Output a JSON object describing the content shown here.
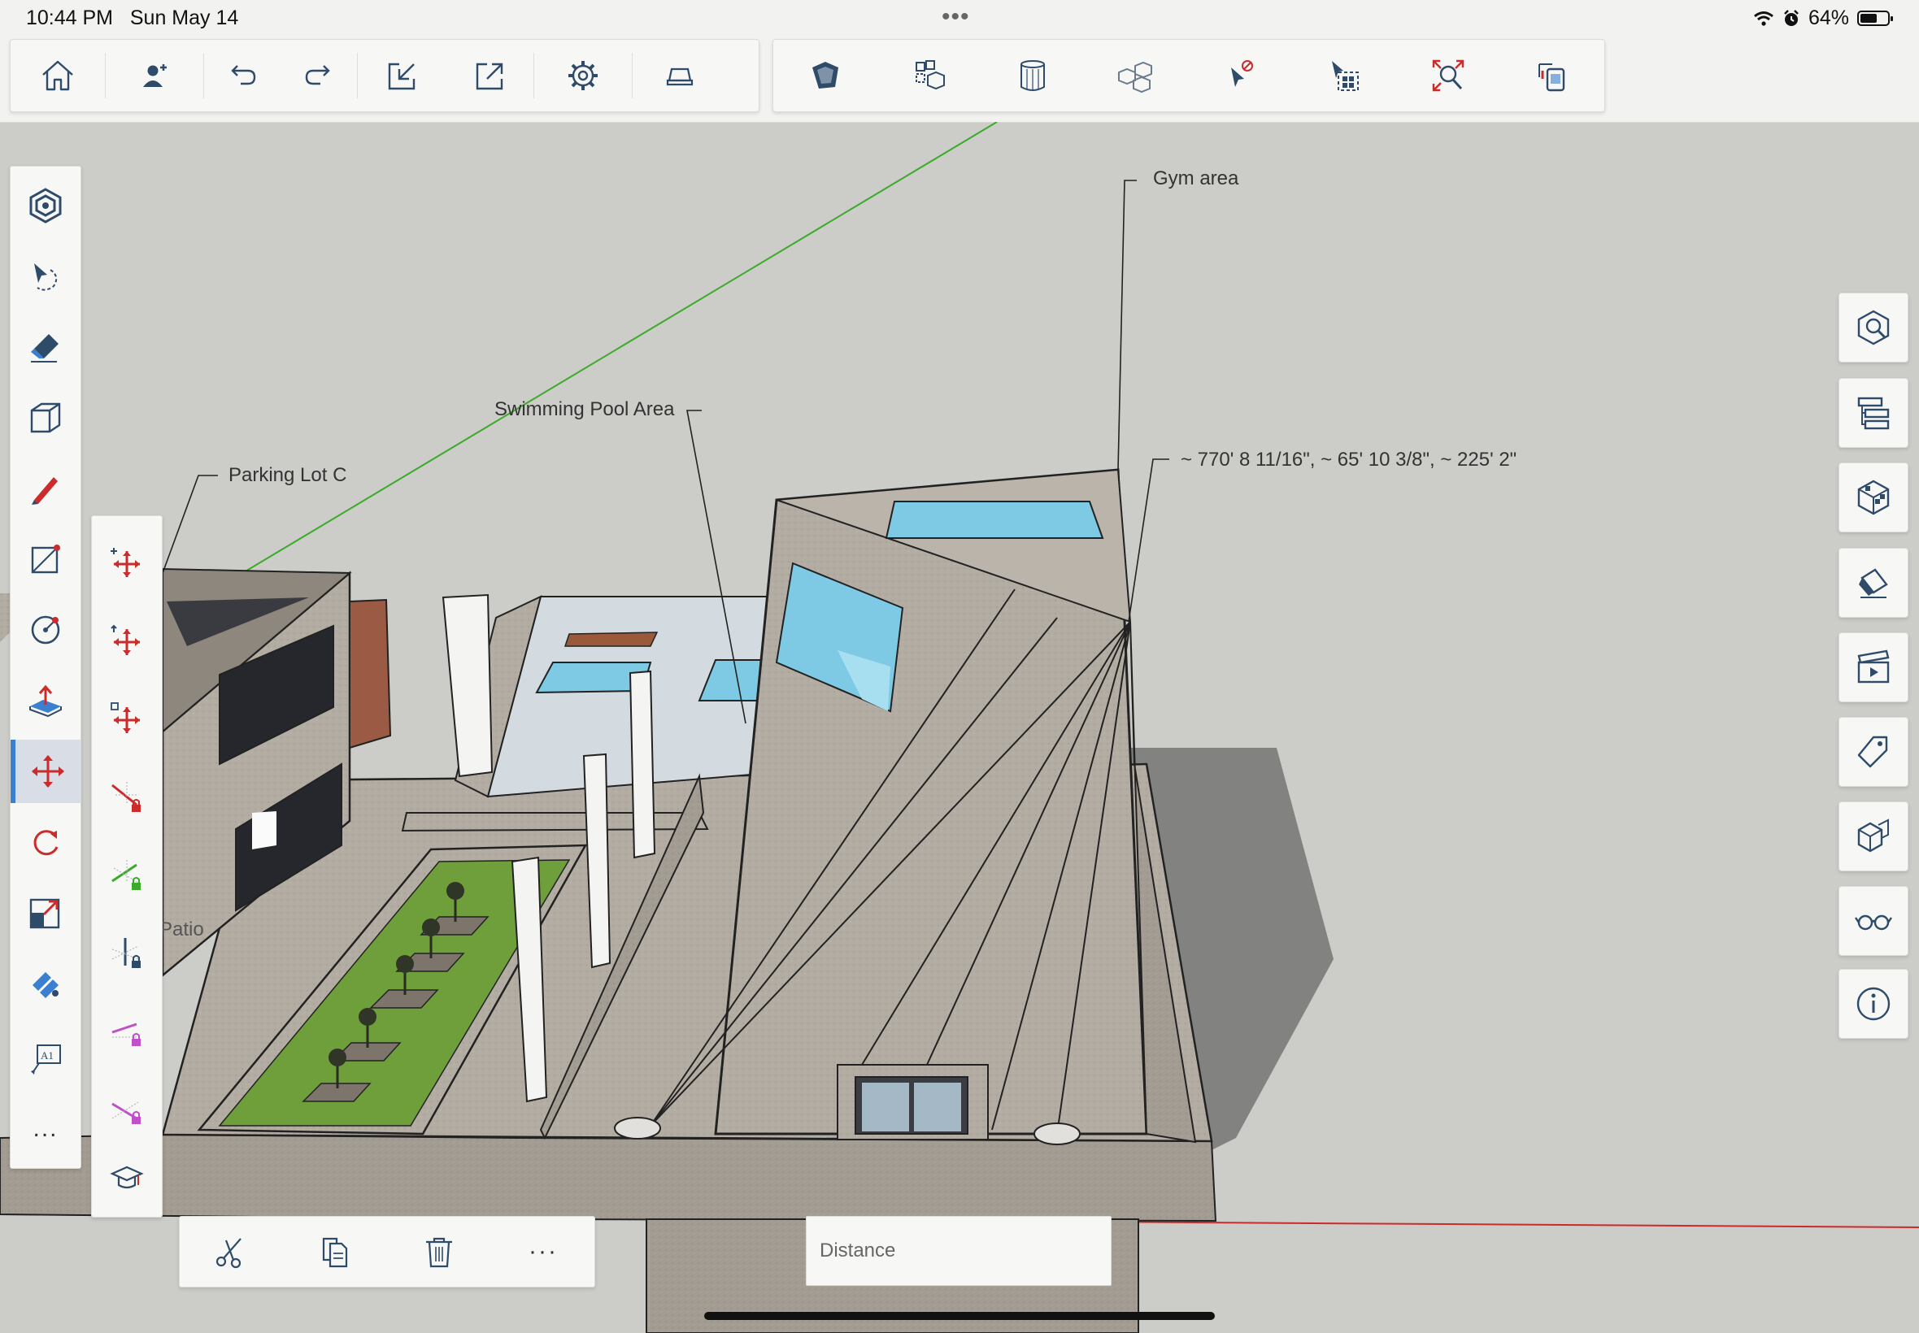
{
  "status": {
    "time": "10:44 PM",
    "date": "Sun May 14",
    "battery_text": "64%",
    "battery_level": 0.64,
    "dots": "•••"
  },
  "toolbar_left": [
    {
      "name": "home-button",
      "icon": "home-icon"
    },
    {
      "name": "profile-button",
      "icon": "add-person-icon"
    },
    {
      "name": "undo-button",
      "icon": "undo-icon"
    },
    {
      "name": "redo-button",
      "icon": "redo-icon"
    },
    {
      "name": "import-button",
      "icon": "import-icon"
    },
    {
      "name": "export-button",
      "icon": "export-icon"
    },
    {
      "name": "settings-button",
      "icon": "gear-icon"
    },
    {
      "name": "hardware-button",
      "icon": "laptop-icon"
    }
  ],
  "toolbar_right": [
    {
      "name": "section-plane-button",
      "icon": "box-section-icon"
    },
    {
      "name": "components-button",
      "icon": "components-icon"
    },
    {
      "name": "solid-button",
      "icon": "cylinder-icon"
    },
    {
      "name": "grouping-button",
      "icon": "cubes-icon"
    },
    {
      "name": "select-none-button",
      "icon": "no-select-cursor-icon"
    },
    {
      "name": "select-all-button",
      "icon": "select-all-icon"
    },
    {
      "name": "zoom-extents-button",
      "icon": "zoom-extents-icon"
    },
    {
      "name": "xray-button",
      "icon": "xray-icon"
    }
  ],
  "labels": {
    "gym": "Gym area",
    "pool": "Swimming Pool Area",
    "parking": "Parking Lot C",
    "coords": "~ 770' 8 11/16\", ~ 65' 10 3/8\", ~ 225' 2\"",
    "patio": "Patio"
  },
  "left_tools": [
    {
      "name": "orbit-tool",
      "icon": "orbit-icon"
    },
    {
      "name": "select-tool",
      "icon": "lasso-select-icon"
    },
    {
      "name": "eraser-tool",
      "icon": "eraser-icon"
    },
    {
      "name": "box-tool",
      "icon": "box-icon"
    },
    {
      "name": "pencil-tool",
      "icon": "pencil-icon"
    },
    {
      "name": "rectangle-tool",
      "icon": "rectangle-icon"
    },
    {
      "name": "circle-tool",
      "icon": "circle-icon"
    },
    {
      "name": "push-pull-tool",
      "icon": "push-pull-icon"
    },
    {
      "name": "move-tool",
      "icon": "move-icon",
      "active": true
    },
    {
      "name": "rotate-tool",
      "icon": "rotate-icon"
    },
    {
      "name": "scale-tool",
      "icon": "scale-icon"
    },
    {
      "name": "paint-tool",
      "icon": "paint-bucket-icon"
    },
    {
      "name": "text-tool",
      "icon": "text-tag-icon"
    },
    {
      "name": "more-tools-button",
      "icon": "more-icon",
      "text": "..."
    }
  ],
  "move_options": [
    {
      "name": "move-free",
      "icon": "move-plus-icon"
    },
    {
      "name": "move-up",
      "icon": "move-up-icon"
    },
    {
      "name": "move-copy",
      "icon": "move-copy-icon"
    },
    {
      "name": "lock-red-axis",
      "icon": "red-axis-lock-icon"
    },
    {
      "name": "lock-green-axis",
      "icon": "green-axis-lock-icon"
    },
    {
      "name": "lock-blue-axis",
      "icon": "blue-axis-lock-icon"
    },
    {
      "name": "lock-magenta-axis",
      "icon": "magenta-axis-lock-icon"
    },
    {
      "name": "lock-inference",
      "icon": "inference-lock-icon"
    },
    {
      "name": "instructor",
      "icon": "graduation-cap-icon"
    }
  ],
  "right_panel": [
    {
      "name": "entity-info-panel",
      "icon": "search-box-icon"
    },
    {
      "name": "outliner-panel",
      "icon": "outliner-icon"
    },
    {
      "name": "materials-panel",
      "icon": "material-cube-icon"
    },
    {
      "name": "styles-panel",
      "icon": "eraser-style-icon"
    },
    {
      "name": "scenes-panel",
      "icon": "clapperboard-icon"
    },
    {
      "name": "tags-panel",
      "icon": "tag-icon"
    },
    {
      "name": "components-panel",
      "icon": "component-box-icon"
    },
    {
      "name": "view-panel",
      "icon": "glasses-icon"
    },
    {
      "name": "info-panel",
      "icon": "info-icon"
    }
  ],
  "edit_bar": [
    {
      "name": "cut-button",
      "icon": "scissors-icon"
    },
    {
      "name": "copy-button",
      "icon": "copy-icon"
    },
    {
      "name": "delete-button",
      "icon": "trash-icon"
    },
    {
      "name": "more-edit-button",
      "icon": "more-icon",
      "text": "···"
    }
  ],
  "vcb": {
    "placeholder": "Distance"
  },
  "colors": {
    "accent": "#3b7fd0",
    "red_axis": "#cc2b2b",
    "green_axis": "#3caa2a",
    "icon": "#2f4b6a",
    "glass": "#7ec9e4",
    "grass": "#7cad3e"
  }
}
